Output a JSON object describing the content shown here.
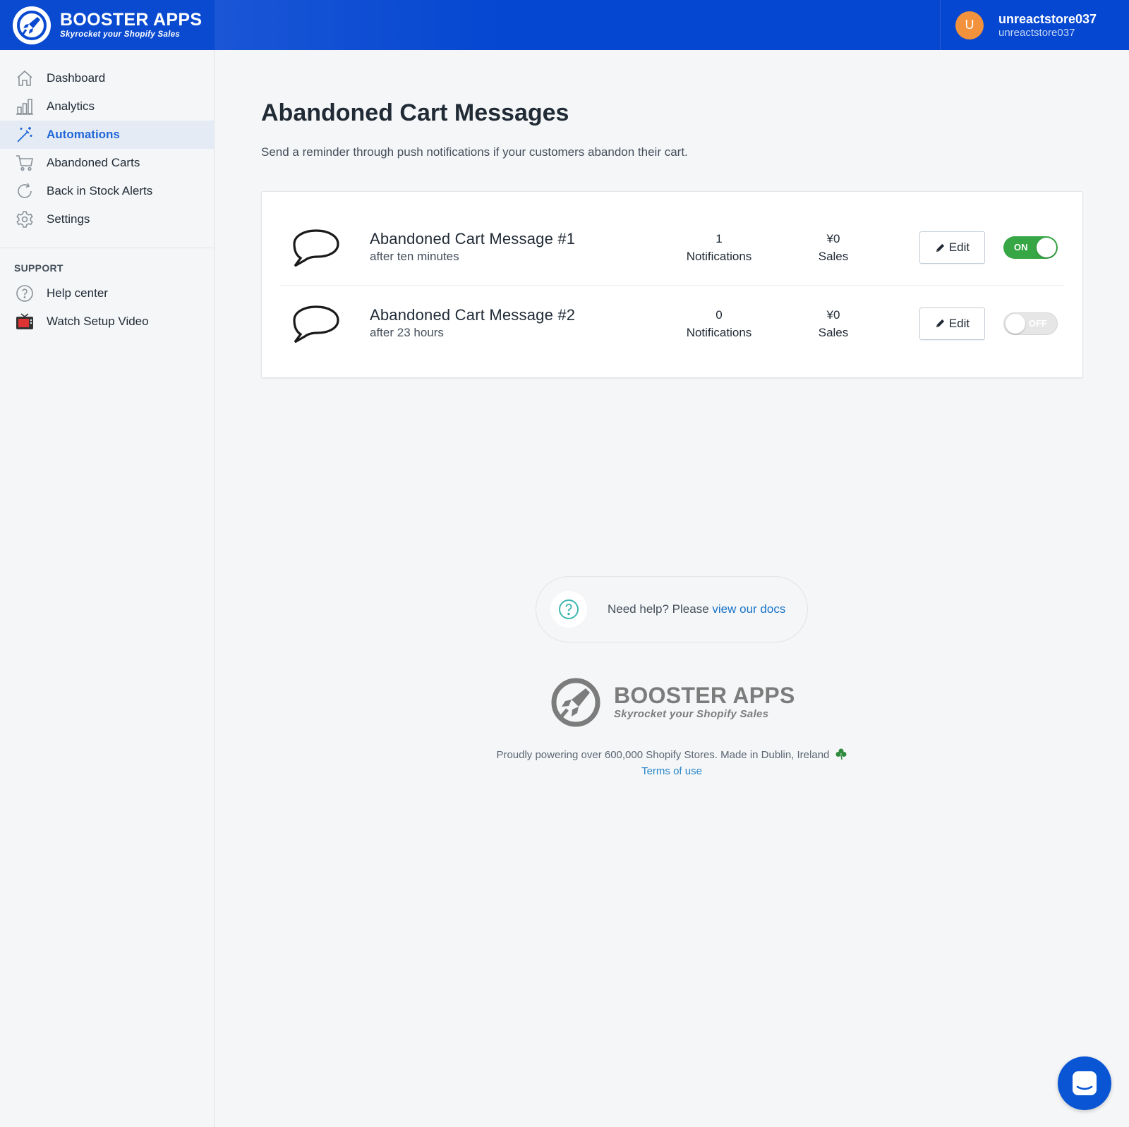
{
  "brand": {
    "title": "BOOSTER APPS",
    "tagline": "Skyrocket your Shopify Sales"
  },
  "user": {
    "initial": "U",
    "name": "unreactstore037",
    "store": "unreactstore037"
  },
  "sidebar": {
    "items": [
      {
        "label": "Dashboard",
        "icon": "home-icon"
      },
      {
        "label": "Analytics",
        "icon": "bar-chart-icon"
      },
      {
        "label": "Automations",
        "icon": "magic-wand-icon",
        "active": true
      },
      {
        "label": "Abandoned Carts",
        "icon": "cart-icon"
      },
      {
        "label": "Back in Stock Alerts",
        "icon": "refresh-icon"
      },
      {
        "label": "Settings",
        "icon": "gear-icon"
      }
    ],
    "support_label": "SUPPORT",
    "support_items": [
      {
        "label": "Help center",
        "icon": "question-circle-icon"
      },
      {
        "label": "Watch Setup Video",
        "icon": "tv-icon"
      }
    ]
  },
  "page": {
    "title": "Abandoned Cart Messages",
    "subtitle": "Send a reminder through push notifications if your customers abandon their cart."
  },
  "messages": [
    {
      "title": "Abandoned Cart Message #1",
      "when": "after ten minutes",
      "notifications": "1",
      "notifications_label": "Notifications",
      "sales": "¥0",
      "sales_label": "Sales",
      "edit_label": "Edit",
      "toggle_label": "ON",
      "enabled": true
    },
    {
      "title": "Abandoned Cart Message #2",
      "when": "after 23 hours",
      "notifications": "0",
      "notifications_label": "Notifications",
      "sales": "¥0",
      "sales_label": "Sales",
      "edit_label": "Edit",
      "toggle_label": "OFF",
      "enabled": false
    }
  ],
  "help": {
    "prefix": "Need help? Please ",
    "link": "view our docs"
  },
  "footer": {
    "title": "BOOSTER APPS",
    "tagline": "Skyrocket your Shopify Sales",
    "note": "Proudly powering over 600,000 Shopify Stores. Made in Dublin, Ireland",
    "note_icon": "shamrock-icon",
    "terms": "Terms of use"
  },
  "colors": {
    "topbar": "#0547d1",
    "accent": "#2166d8",
    "toggle_on": "#36a744",
    "avatar": "#f3923d"
  }
}
